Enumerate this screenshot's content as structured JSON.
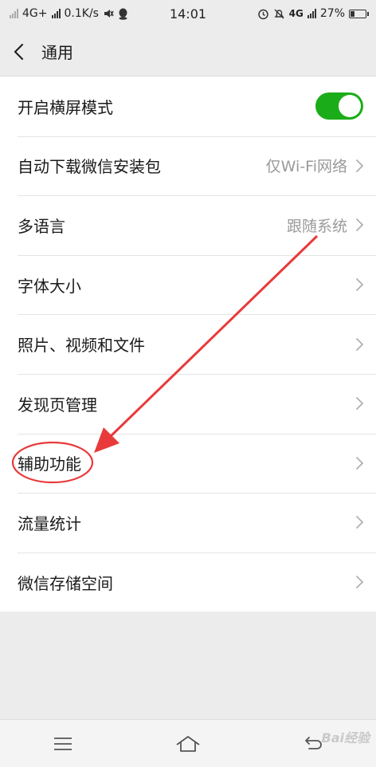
{
  "status": {
    "network": "4G+",
    "speed": "0.1K/s",
    "time": "14:01",
    "network2": "4G",
    "battery": "27%"
  },
  "header": {
    "back_icon": "chevron-left-icon",
    "title": "通用"
  },
  "settings": {
    "landscape": {
      "label": "开启横屏模式",
      "toggle_on": true
    },
    "auto_download": {
      "label": "自动下载微信安装包",
      "value": "仅Wi-Fi网络"
    },
    "language": {
      "label": "多语言",
      "value": "跟随系统"
    },
    "font_size": {
      "label": "字体大小"
    },
    "media": {
      "label": "照片、视频和文件"
    },
    "discover": {
      "label": "发现页管理"
    },
    "accessibility": {
      "label": "辅助功能"
    },
    "traffic": {
      "label": "流量统计"
    },
    "storage": {
      "label": "微信存储空间"
    }
  },
  "bottom_nav": {
    "menu_icon": "menu-icon",
    "home_icon": "home-icon",
    "back_icon": "back-icon"
  },
  "watermark": "Bai经验",
  "colors": {
    "toggle_on": "#1aad19",
    "annotation": "#e83a3a"
  }
}
